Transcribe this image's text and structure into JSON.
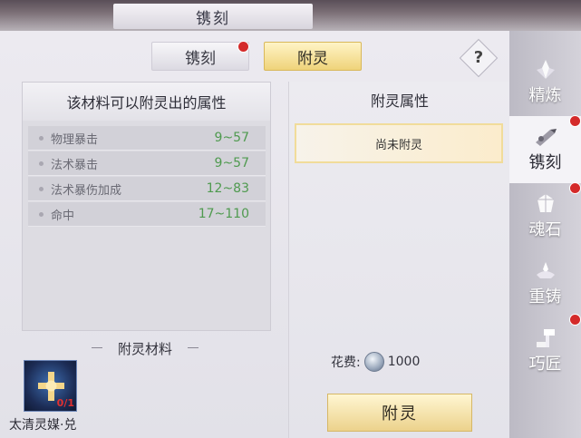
{
  "window": {
    "title": "镌刻"
  },
  "tabs": [
    {
      "label": "镌刻",
      "active": false,
      "badge": true
    },
    {
      "label": "附灵",
      "active": true,
      "badge": false
    }
  ],
  "help": {
    "label": "?"
  },
  "left_panel": {
    "title": "该材料可以附灵出的属性",
    "attributes": [
      {
        "name": "物理暴击",
        "range": "9~57"
      },
      {
        "name": "法术暴击",
        "range": "9~57"
      },
      {
        "name": "法术暴伤加成",
        "range": "12~83"
      },
      {
        "name": "命中",
        "range": "17~110"
      }
    ]
  },
  "materials": {
    "section_label": "附灵材料",
    "item_name": "太清灵媒·兑",
    "count": "0/1"
  },
  "right_panel": {
    "title": "附灵属性",
    "slot_text": "尚未附灵",
    "cost_label": "花费:",
    "cost_value": "1000",
    "action_button": "附灵"
  },
  "sidebar": [
    {
      "label": "精炼",
      "icon": "refine-icon",
      "active": false,
      "badge": false
    },
    {
      "label": "镌刻",
      "icon": "engrave-icon",
      "active": true,
      "badge": true
    },
    {
      "label": "魂石",
      "icon": "soulstone-icon",
      "active": false,
      "badge": true
    },
    {
      "label": "重铸",
      "icon": "recast-icon",
      "active": false,
      "badge": false
    },
    {
      "label": "巧匠",
      "icon": "craftsman-icon",
      "active": false,
      "badge": true
    }
  ],
  "colors": {
    "accent_gold": "#efd37a",
    "badge_red": "#d42a2a",
    "value_green": "#4f9a4f"
  }
}
